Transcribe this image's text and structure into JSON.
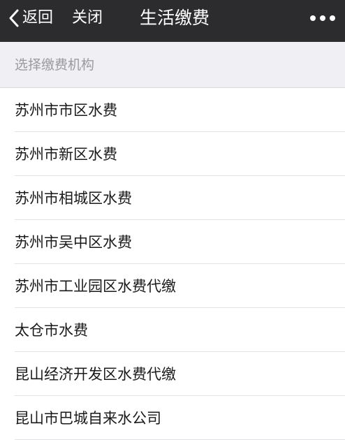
{
  "navbar": {
    "back_label": "返回",
    "close_label": "关闭",
    "title": "生活缴费",
    "more_icon": "more-dots-icon"
  },
  "section": {
    "label": "选择缴费机构"
  },
  "institutions": [
    {
      "label": "苏州市市区水费"
    },
    {
      "label": "苏州市新区水费"
    },
    {
      "label": "苏州市相城区水费"
    },
    {
      "label": "苏州市吴中区水费"
    },
    {
      "label": "苏州市工业园区水费代缴"
    },
    {
      "label": "太仓市水费"
    },
    {
      "label": "昆山经济开发区水费代缴"
    },
    {
      "label": "昆山市巴城自来水公司"
    }
  ],
  "colors": {
    "navbar_bg": "#2c2c2e",
    "section_bg": "#efeff4",
    "text": "#1a1a1a",
    "muted": "#9a9a9f"
  }
}
